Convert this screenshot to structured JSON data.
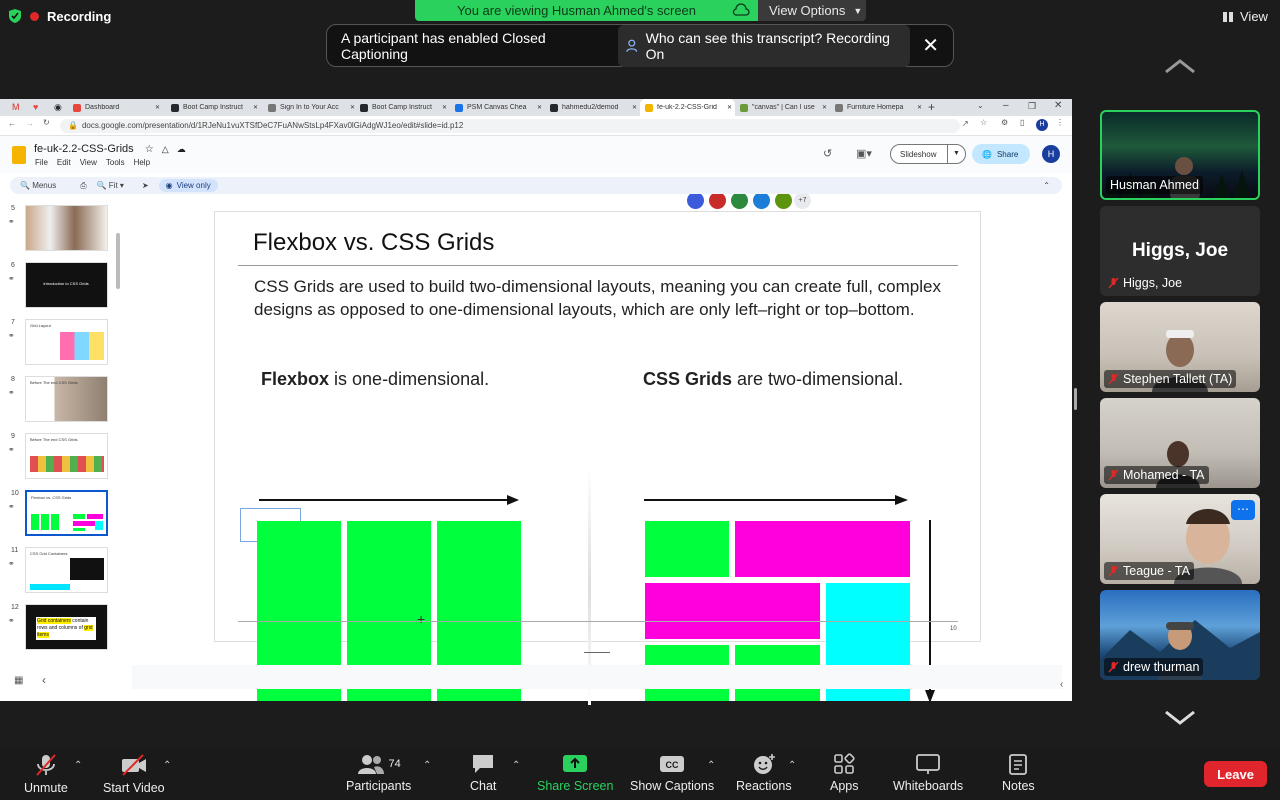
{
  "zoom": {
    "recording_label": "Recording",
    "viewing_banner": "You are viewing Husman Ahmed's screen",
    "view_options_label": "View Options",
    "view_label": "View",
    "caption_notice": "A participant has enabled Closed Captioning",
    "caption_chip": "Who can see this transcript? Recording On",
    "colors": {
      "banner": "#2bd15d",
      "leave": "#e0252c",
      "share": "#2bd15d"
    }
  },
  "browser": {
    "tabs": [
      {
        "label": "Dashboard",
        "color": "#e8453c"
      },
      {
        "label": "Boot Camp Instruct",
        "color": "#24292f"
      },
      {
        "label": "Sign In to Your Acc",
        "color": "#777777"
      },
      {
        "label": "Boot Camp Instruct",
        "color": "#24292f"
      },
      {
        "label": "PSM Canvas Chea",
        "color": "#1a73e8"
      },
      {
        "label": "hahmedu2/demod",
        "color": "#24292f"
      },
      {
        "label": "fe-uk-2.2-CSS-Grid",
        "color": "#f4b400"
      },
      {
        "label": "\"canvas\" | Can I use",
        "color": "#6a9a3a"
      },
      {
        "label": "Furniture Homepa",
        "color": "#777777"
      }
    ],
    "url": "docs.google.com/presentation/d/1RJeNu1vuXTSfDeC7FuANwStsLp4FXav0lGiAdgWJ1eo/edit#slide=id.p12"
  },
  "slides_app": {
    "doc_title": "fe-uk-2.2-CSS-Grids",
    "menus": [
      "File",
      "Edit",
      "View",
      "Tools",
      "Help"
    ],
    "toolbar": {
      "menus_search": "Menus",
      "zoom": "Fit",
      "view_only": "View only"
    },
    "extra_collaborators": "+7",
    "slideshow_label": "Slideshow",
    "share_label": "Share",
    "account_initial": "H",
    "thumbnails": [
      {
        "num": "5",
        "caption": ""
      },
      {
        "num": "6",
        "caption": "Introduction to CSS Grids"
      },
      {
        "num": "7",
        "caption": "Grid Layout"
      },
      {
        "num": "8",
        "caption": "Before The end CSS Grids"
      },
      {
        "num": "9",
        "caption": "Before The end CSS Grids"
      },
      {
        "num": "10",
        "caption": "Flexbox vs. CSS Grids"
      },
      {
        "num": "11",
        "caption": "CSS Grid Containers"
      },
      {
        "num": "12",
        "caption_hl1": "Grid containers",
        "caption_rest": " contain rows and columns of ",
        "caption_hl2": "grid items"
      }
    ]
  },
  "slide": {
    "title": "Flexbox vs. CSS Grids",
    "body": "CSS Grids are used to build two-dimensional layouts, meaning you can create full, complex designs as opposed to one-dimensional layouts, which are only left–right or top–bottom.",
    "flex_bold": "Flexbox",
    "flex_rest": " is one-dimensional.",
    "grid_bold": "CSS Grids",
    "grid_rest": " are two-dimensional.",
    "page_number": "10",
    "colors": {
      "green": "#00ff3c",
      "magenta": "#ff00dc",
      "cyan": "#00ffff"
    }
  },
  "participants": [
    {
      "name": "Husman Ahmed",
      "muted": false
    },
    {
      "name": "Higgs, Joe",
      "display_big": "Higgs, Joe",
      "muted": true
    },
    {
      "name": "Stephen Tallett (TA)",
      "muted": true
    },
    {
      "name": "Mohamed - TA",
      "muted": true
    },
    {
      "name": "Teague - TA",
      "muted": true
    },
    {
      "name": "drew thurman",
      "muted": true
    }
  ],
  "controls": {
    "unmute": "Unmute",
    "start_video": "Start Video",
    "participants": "Participants",
    "participant_count": "74",
    "chat": "Chat",
    "share_screen": "Share Screen",
    "show_captions": "Show Captions",
    "reactions": "Reactions",
    "apps": "Apps",
    "whiteboards": "Whiteboards",
    "notes": "Notes",
    "leave": "Leave"
  }
}
